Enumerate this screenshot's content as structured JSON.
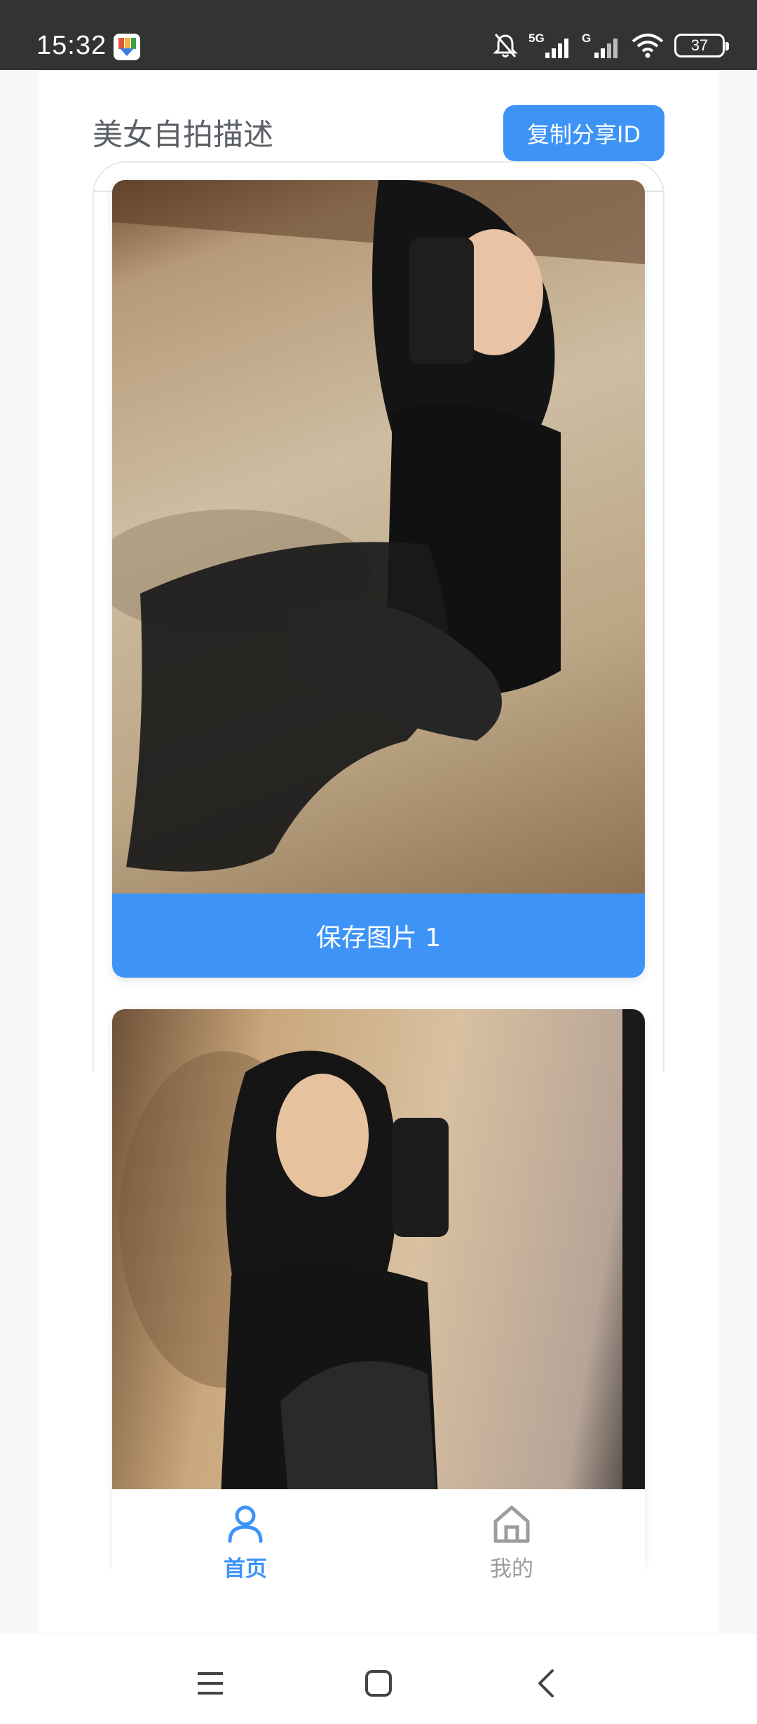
{
  "status_bar": {
    "time": "15:32",
    "battery_level": "37",
    "app_icon": "app-notification-icon",
    "icons": [
      "bell-muted-icon",
      "signal-5g-icon",
      "signal-g-icon",
      "wifi-icon",
      "battery-icon"
    ],
    "signal_1_label": "5G",
    "signal_2_label": "G"
  },
  "header": {
    "title": "美女自拍描述",
    "share_button_label": "复制分享ID"
  },
  "cards": [
    {
      "save_label": "保存图片 1"
    }
  ],
  "tab_bar": {
    "items": [
      {
        "label": "首页",
        "icon": "user-icon",
        "active": true
      },
      {
        "label": "我的",
        "icon": "home-icon",
        "active": false
      }
    ]
  },
  "nav_bar": {
    "icons": [
      "menu-icon",
      "home-square-icon",
      "back-icon"
    ]
  },
  "colors": {
    "accent": "#3d94f6",
    "status_bar_bg": "#333333",
    "inactive": "#9a9ca0"
  }
}
